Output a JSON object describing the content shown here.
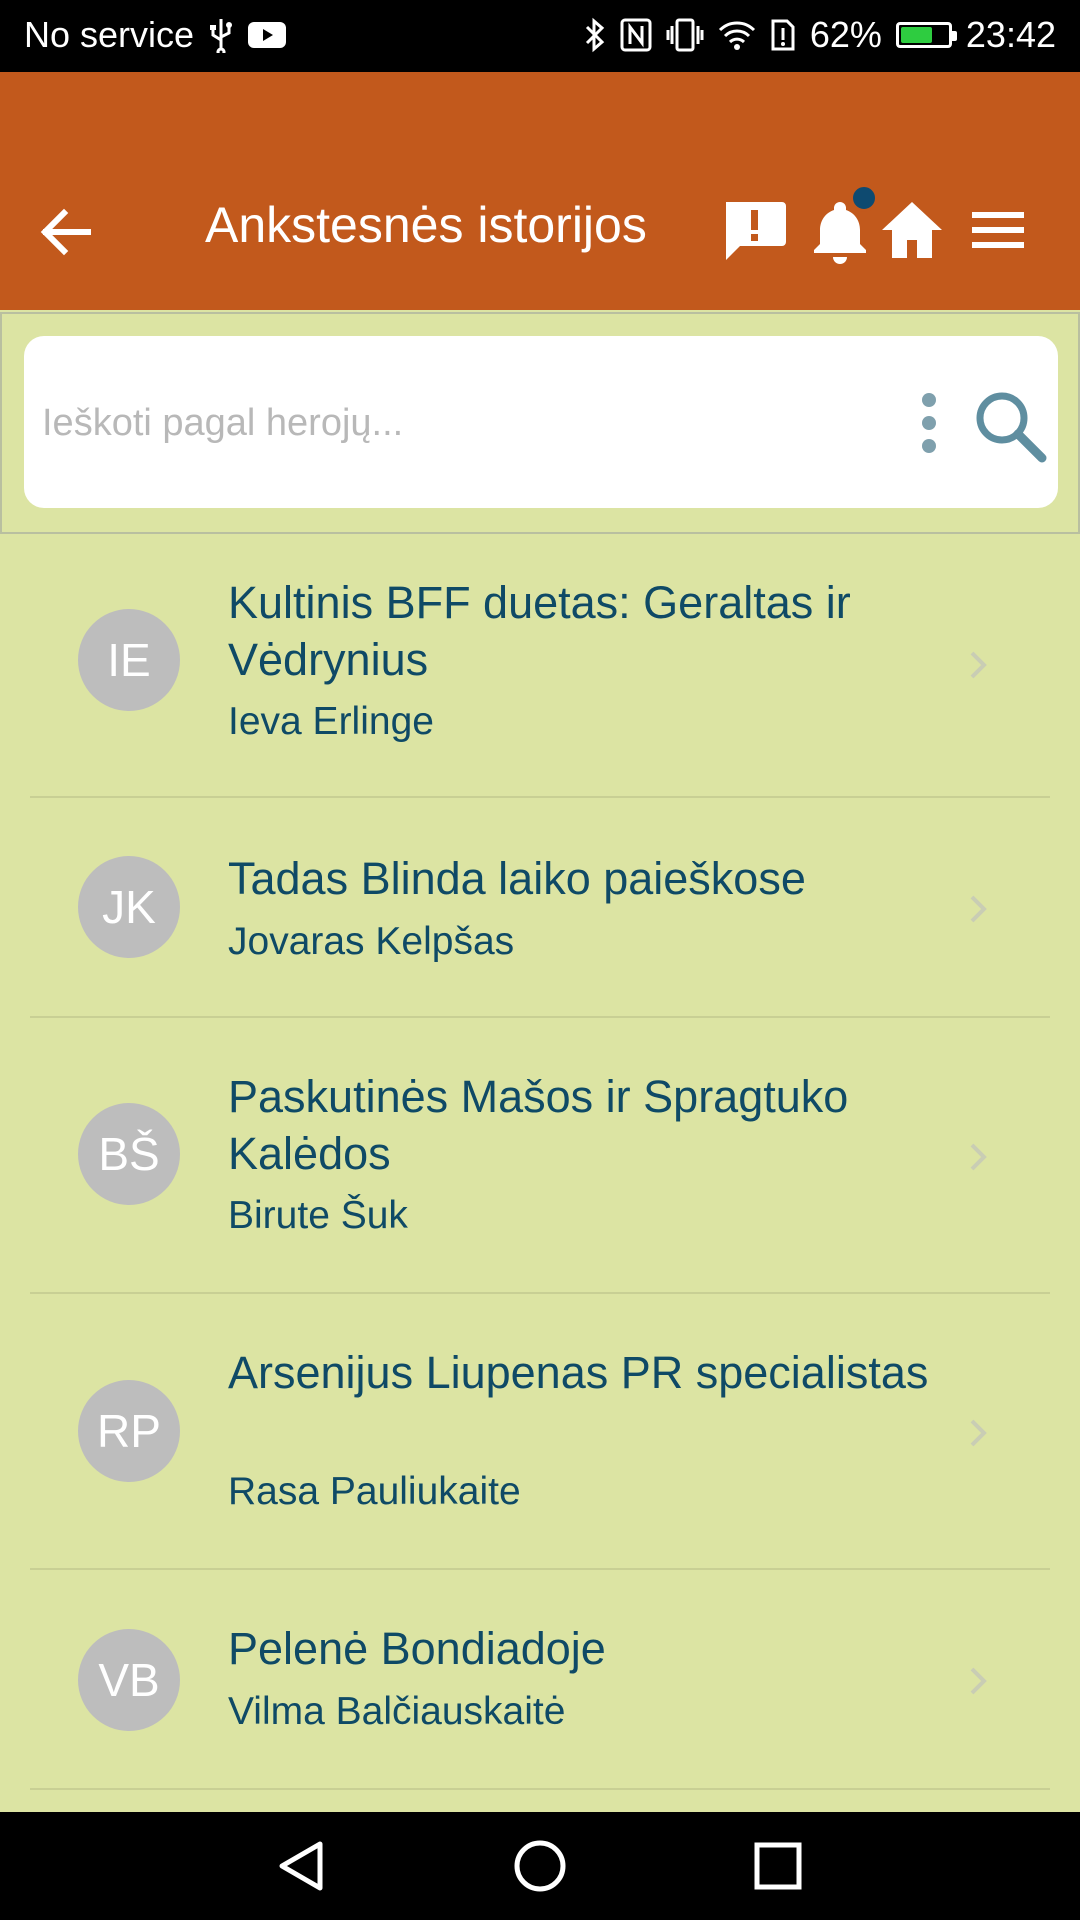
{
  "status_bar": {
    "carrier": "No service",
    "battery_percent": "62%",
    "battery_level": 0.62,
    "time": "23:42",
    "icons": [
      "usb-icon",
      "youtube-icon",
      "bluetooth-icon",
      "nfc-icon",
      "vibrate-icon",
      "wifi-icon",
      "alert-icon",
      "battery-icon"
    ]
  },
  "app_bar": {
    "title": "Ankstesnės istorijos",
    "actions": [
      "report-icon",
      "notification-bell-icon",
      "home-icon",
      "menu-icon"
    ]
  },
  "search": {
    "placeholder": "Ieškoti pagal herojų...",
    "value": ""
  },
  "stories": [
    {
      "initials": "IE",
      "title": "Kultinis BFF duetas: Geraltas ir Vėdrynius",
      "author": "Ieva Erlinge"
    },
    {
      "initials": "JK",
      "title": "Tadas Blinda laiko paieškose",
      "author": "Jovaras Kelpšas"
    },
    {
      "initials": "BŠ",
      "title": "Paskutinės Mašos ir Spragtuko Kalėdos",
      "author": "Birute Šuk"
    },
    {
      "initials": "RP",
      "title": "Arsenijus Liupenas PR specialistas",
      "author": "Rasa Pauliukaite"
    },
    {
      "initials": "VB",
      "title": "Pelenė Bondiadoje",
      "author": "Vilma Balčiauskaitė"
    }
  ],
  "colors": {
    "app_bar": "#c2591c",
    "background": "#dce4a3",
    "text": "#0f4a66",
    "avatar": "#bdbdbd"
  }
}
